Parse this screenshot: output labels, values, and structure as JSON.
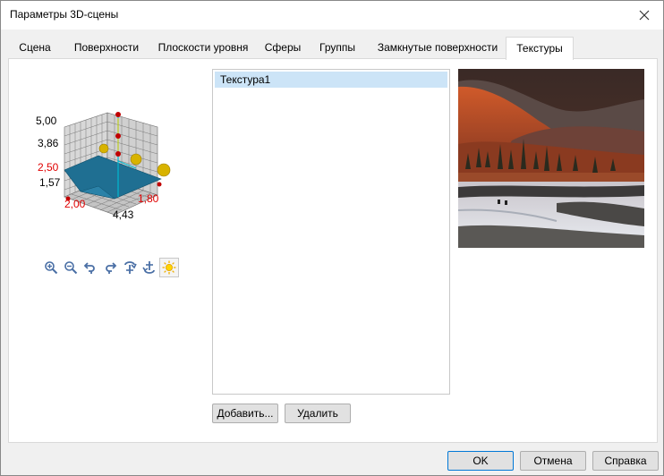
{
  "window": {
    "title": "Параметры 3D-сцены"
  },
  "tabs": [
    {
      "label": "Сцена"
    },
    {
      "label": "Поверхности"
    },
    {
      "label": "Плоскости уровня"
    },
    {
      "label": "Сферы"
    },
    {
      "label": "Группы"
    },
    {
      "label": "Замкнутые поверхности"
    },
    {
      "label": "Текстуры"
    }
  ],
  "active_tab": "Текстуры",
  "chart": {
    "axis_labels": [
      {
        "text": "5,00",
        "color": "#000000"
      },
      {
        "text": "3,86",
        "color": "#000000"
      },
      {
        "text": "2,50",
        "color": "#e00000"
      },
      {
        "text": "1,57",
        "color": "#000000"
      },
      {
        "text": "2,00",
        "color": "#e00000"
      },
      {
        "text": "1,80",
        "color": "#e00000"
      },
      {
        "text": "4,43",
        "color": "#000000"
      }
    ],
    "colors": {
      "surface": "#1f6f92",
      "grid": "#6b6b6b",
      "marker": "#e0b200",
      "point": "#c00000",
      "axis": "#00b7d0"
    }
  },
  "toolbar": {
    "icons": [
      "zoom-in-icon",
      "zoom-out-icon",
      "rotate-left-icon",
      "rotate-right-icon",
      "rotate-down-icon",
      "rotate-up-icon",
      "light-icon"
    ]
  },
  "textures": {
    "items": [
      {
        "label": "Текстура1",
        "selected": true
      }
    ],
    "add_label": "Добавить...",
    "delete_label": "Удалить"
  },
  "footer": {
    "ok_label": "OK",
    "cancel_label": "Отмена",
    "help_label": "Справка"
  }
}
